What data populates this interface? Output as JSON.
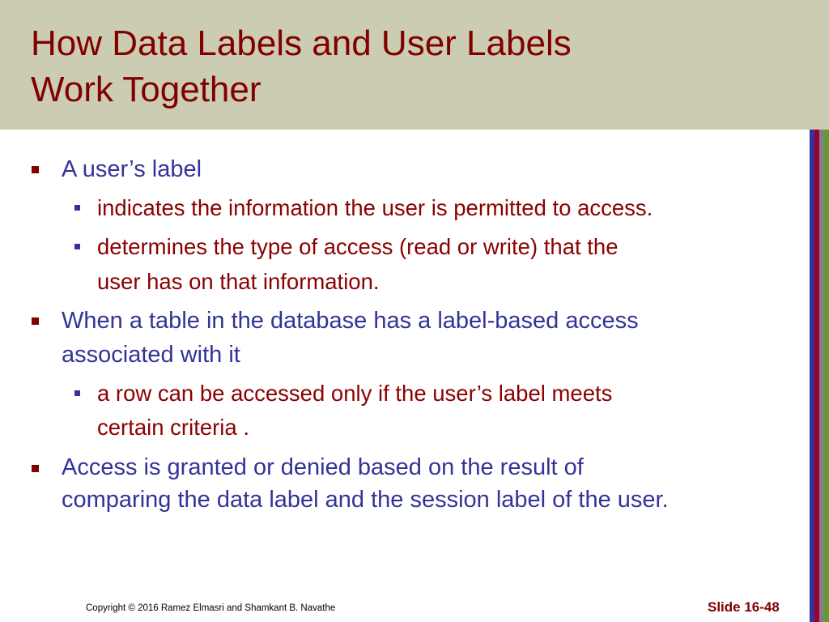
{
  "slide": {
    "title_lines": [
      "How Data Labels and User Labels",
      "Work Together"
    ],
    "bullets": [
      {
        "level": 1,
        "lines": [
          "A user’s label"
        ]
      },
      {
        "level": 2,
        "lines": [
          "indicates the information the user is permitted to access."
        ]
      },
      {
        "level": 2,
        "lines": [
          " determines the type of access (read or write) that the",
          "user has on that information."
        ]
      },
      {
        "level": 1,
        "lines": [
          "When a table in the database has a label-based access",
          "associated with it"
        ]
      },
      {
        "level": 2,
        "lines": [
          " a row can be accessed only if the user’s label meets",
          "certain criteria ."
        ]
      },
      {
        "level": 1,
        "lines": [
          "Access is granted or denied based on the result of",
          "comparing the data label and the session label of the user."
        ]
      }
    ],
    "footer": {
      "copyright": "Copyright © 2016 Ramez Elmasri and Shamkant B. Navathe",
      "slide_number": "Slide 16-48"
    }
  },
  "colors": {
    "title_band": "#ccccb2",
    "title_text": "#800000",
    "level1_text": "#333399",
    "level2_text": "#8b0000",
    "stripes": [
      "#333399",
      "#990033",
      "#808080",
      "#669933"
    ]
  }
}
